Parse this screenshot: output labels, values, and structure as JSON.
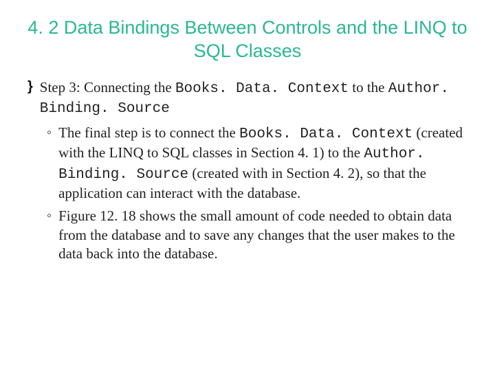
{
  "title": "4. 2 Data Bindings Between Controls and the LINQ to SQL Classes",
  "bullet": {
    "pre": "Step 3: Connecting the ",
    "code1": "Books. Data. Context",
    "mid": " to the ",
    "code2": "Author. Binding. Source"
  },
  "sub": [
    {
      "t1": "The final step is to connect the ",
      "c1": "Books. Data. Context",
      "t2": " (created with the LINQ to SQL classes in Section 4. 1) to the ",
      "c2": "Author. Binding. Source",
      "t3": " (created with in Section 4. 2), so that the application can interact with the database."
    },
    {
      "t1": "Figure 12. 18 shows the small amount of code needed to obtain data from the database and to save any changes that the user makes to the data back into the database."
    }
  ]
}
